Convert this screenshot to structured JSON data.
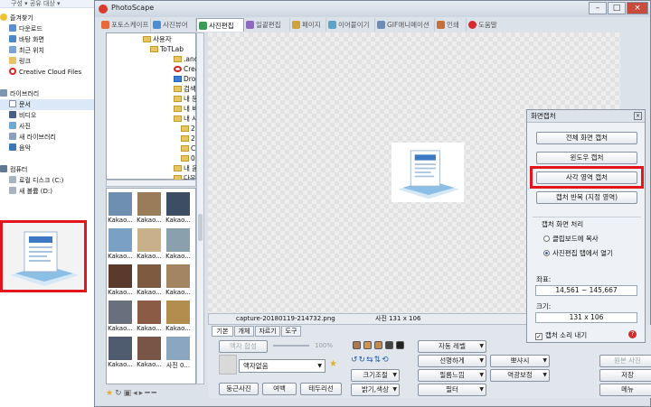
{
  "explorer": {
    "topbar": "구성 ▾      공유 대상 ▾",
    "favorites_label": "즐겨찾기",
    "favorites": [
      "다운로드",
      "바탕 화면",
      "최근 위치",
      "링크",
      "Creative Cloud Files"
    ],
    "libraries_label": "라이브러리",
    "libraries": [
      "문서",
      "비디오",
      "사진",
      "새 라이브러리",
      "음악"
    ],
    "computer_label": "컴퓨터",
    "drives": [
      "로컬 디스크 (C:)",
      "새 볼륨 (D:)"
    ]
  },
  "app": {
    "title": "PhotoScape",
    "tabs": [
      "포토스케이프",
      "사진뷰어",
      "사진편집",
      "일괄편집",
      "페이지",
      "이어붙이기",
      "GIF애니메이션",
      "인쇄",
      "도움말"
    ],
    "tree": [
      "사용자",
      "ToTLab",
      ".andr",
      "Creat",
      "Drop",
      "검색",
      "내 문",
      "내 비",
      "내 사",
      "2",
      "2",
      "C",
      "0",
      "내 음",
      "다운",
      "링크"
    ],
    "thumb_labels": [
      "Kakao...",
      "Kakao...",
      "Kakao...",
      "Kakao...",
      "Kakao...",
      "Kakao...",
      "Kakao...",
      "Kakao...",
      "Kakao...",
      "Kakao...",
      "Kakao...",
      "Kakao...",
      "Kakao...",
      "Kakao...",
      "Kakao...",
      "Kakao...",
      "Kakao...",
      "사진 0..."
    ],
    "status": {
      "filename": "capture-20180119-214732.png",
      "size": "사진 131 x 106"
    },
    "zoom": "100%",
    "bottom": {
      "subtabs": [
        "기본",
        "개체",
        "자르기",
        "도구"
      ],
      "frame_button": "액자 합성",
      "frame_select": "액자없음",
      "round_button": "둥근사진",
      "margin_button": "여백",
      "border_button": "테두리선",
      "effects": [
        "자동 레벨",
        "선명하게",
        "필름느낌",
        "필터",
        "뽀샤시",
        "역광보정"
      ],
      "resize": "크기조절",
      "brightness": "밝기,색상",
      "original": "원본 사진",
      "save": "저장",
      "menu": "메뉴"
    }
  },
  "capture": {
    "title": "화면캡처",
    "full": "전체 화면 캡처",
    "window": "윈도우 캡처",
    "region": "사각 영역 캡처",
    "repeat": "캡처 반복 (지정 영역)",
    "after_label": "캡처 화면 처리",
    "opt_clipboard": "클립보드에 복사",
    "opt_editor": "사진편집 탭에서 열기",
    "coords_label": "좌표:",
    "coords": "14,561 ~ 145,667",
    "size_label": "크기:",
    "size": "131 x 106",
    "sound": "캡처 소리 내기"
  },
  "colors": {
    "highlight": "#e3141c",
    "accent": "#2a5fb0"
  }
}
